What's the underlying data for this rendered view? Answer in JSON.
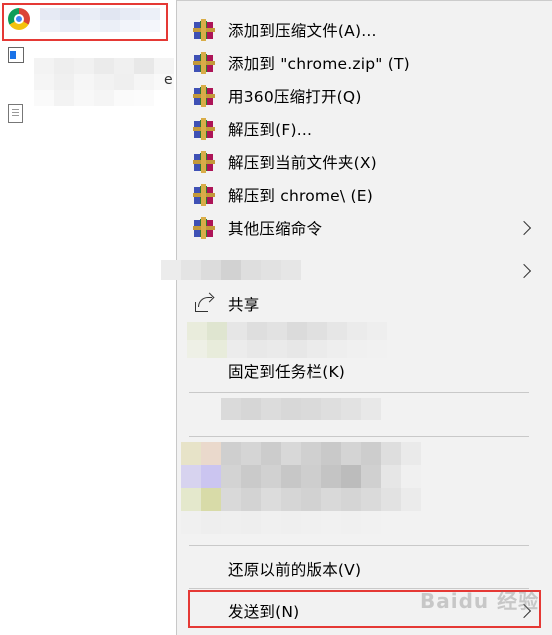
{
  "explorer": {
    "files": [
      {
        "icon": "chrome-icon"
      },
      {
        "icon": "app-icon"
      },
      {
        "icon": "document-icon"
      }
    ],
    "clipped_text": "e"
  },
  "menu": {
    "items": [
      {
        "label": "添加到压缩文件(A)...",
        "icon": "winrar-icon",
        "submenu": false
      },
      {
        "label": "添加到 \"chrome.zip\" (T)",
        "icon": "winrar-icon",
        "submenu": false
      },
      {
        "label": "用360压缩打开(Q)",
        "icon": "winrar-icon",
        "submenu": false
      },
      {
        "label": "解压到(F)...",
        "icon": "winrar-icon",
        "submenu": false
      },
      {
        "label": "解压到当前文件夹(X)",
        "icon": "winrar-icon",
        "submenu": false
      },
      {
        "label": "解压到 chrome\\ (E)",
        "icon": "winrar-icon",
        "submenu": false
      },
      {
        "label": "其他压缩命令",
        "icon": "winrar-icon",
        "submenu": true
      }
    ],
    "share_label": "共享",
    "pin_taskbar_label": "固定到任务栏(K)",
    "restore_label": "还原以前的版本(V)",
    "send_to_label": "发送到(N)"
  },
  "watermark": "Baidu 经验",
  "colors": {
    "highlight": "#e53935",
    "menu_bg": "#f2f2f2"
  }
}
